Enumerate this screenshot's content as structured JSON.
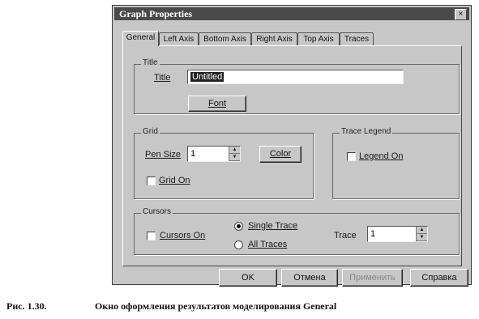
{
  "window": {
    "title": "Graph Properties",
    "close_glyph": "×"
  },
  "tabs": [
    {
      "label": "General",
      "active": true
    },
    {
      "label": "Left Axis",
      "active": false
    },
    {
      "label": "Bottom Axis",
      "active": false
    },
    {
      "label": "Right Axis",
      "active": false
    },
    {
      "label": "Top Axis",
      "active": false
    },
    {
      "label": "Traces",
      "active": false
    }
  ],
  "title_group": {
    "label": "Title",
    "field_label": "Title",
    "field_value": "Untitled",
    "font_button": "Font"
  },
  "grid_group": {
    "label": "Grid",
    "pen_size_label": "Pen Size",
    "pen_size_value": "1",
    "color_button": "Color",
    "grid_on_label": "Grid On",
    "grid_on_checked": false
  },
  "trace_legend_group": {
    "label": "Trace Legend",
    "legend_on_label": "Legend On",
    "legend_on_checked": false
  },
  "cursors_group": {
    "label": "Cursors",
    "cursors_on_label": "Cursors On",
    "cursors_on_checked": false,
    "single_trace_label": "Single Trace",
    "all_traces_label": "All Traces",
    "selected": "Single Trace",
    "trace_label": "Trace",
    "trace_value": "1"
  },
  "buttons": {
    "ok": "OK",
    "cancel": "Отмена",
    "apply": "Применить",
    "help": "Справка"
  },
  "caption": {
    "fig": "Рис. 1.30.",
    "text": "Окно оформления результатов моделирования General"
  },
  "icons": {
    "spin_up": "▲",
    "spin_down": "▼"
  }
}
